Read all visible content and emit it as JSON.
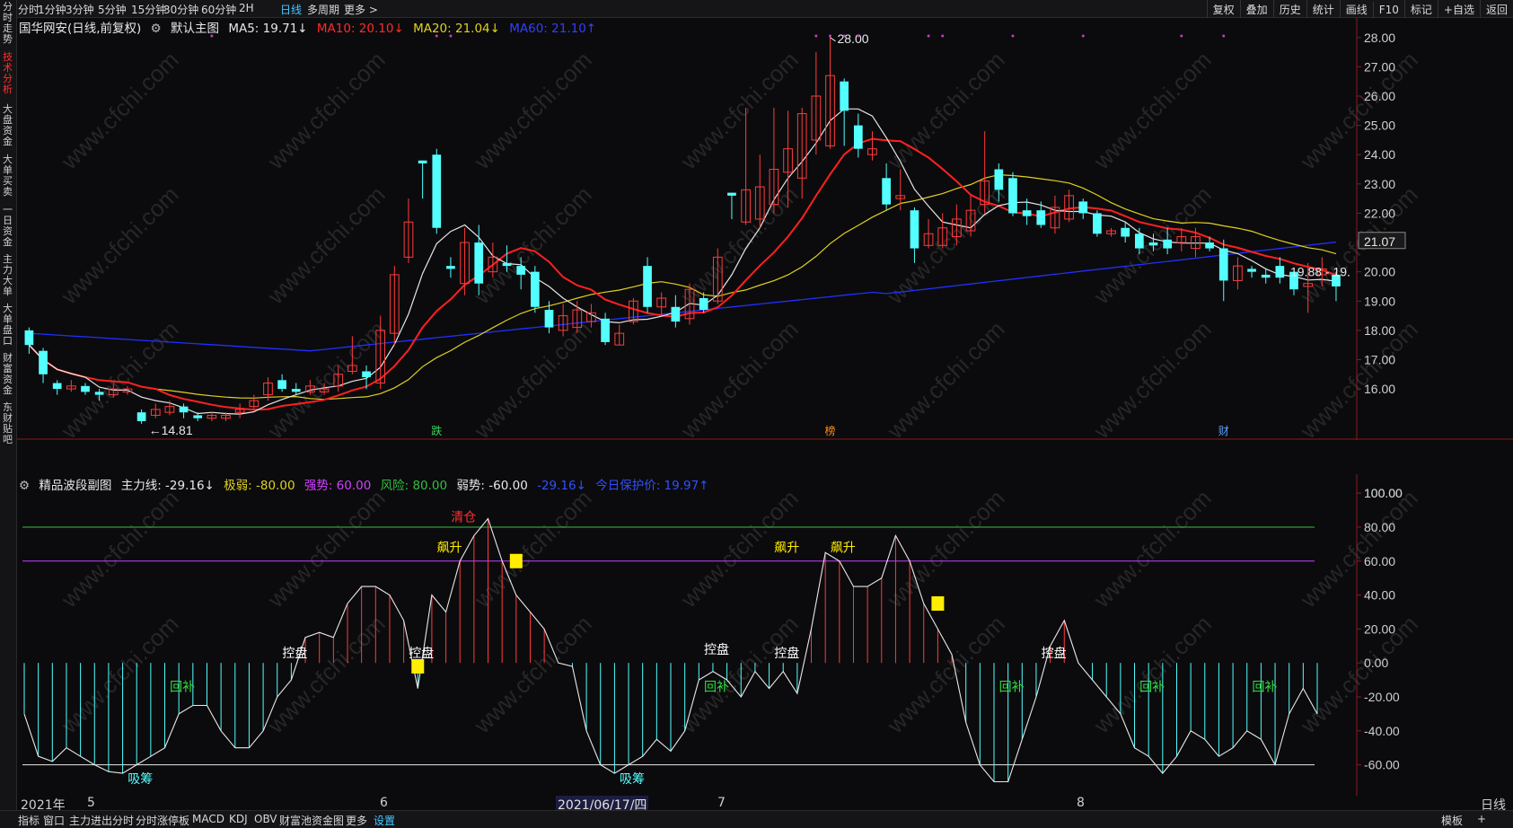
{
  "topbar": {
    "periods": [
      "分时",
      "1分钟",
      "3分钟",
      "5分钟",
      "15分钟",
      "30分钟",
      "60分钟",
      "2H",
      "日线",
      "多周期",
      "更多 >"
    ],
    "active_period": "日线",
    "tools": [
      "复权",
      "叠加",
      "历史",
      "统计",
      "画线",
      "F10",
      "标记",
      "+自选",
      "返回"
    ]
  },
  "leftnav": [
    "分时走势",
    "技术分析",
    "大盘资金",
    "大单买卖",
    "一日资金",
    "主力大单",
    "大单盘口",
    "财富资金",
    "东财贴吧"
  ],
  "leftnav_active": "技术分析",
  "main_header": {
    "stock": "国华网安(日线,前复权)",
    "template": "默认主图",
    "ma5": "MA5: 19.71↓",
    "ma10": "MA10: 20.10↓",
    "ma20": "MA20: 21.04↓",
    "ma60": "MA60: 21.10↑"
  },
  "sub_header": {
    "name": "精品波段副图",
    "main": "主力线: -29.16↓",
    "jiruo": "极弱: -80.00",
    "qiangshi": "强势: 60.00",
    "fengxian": "风险: 80.00",
    "ruoshi": "弱势: -60.00",
    "value2": "-29.16↓",
    "protect": "今日保护价: 19.97↑"
  },
  "price_labels": {
    "high": "28.00",
    "low": "14.81",
    "last_left": "19.88 - 19.",
    "last_box": "21.07"
  },
  "badges": [
    {
      "text": "跌",
      "color": "#3cd25a"
    },
    {
      "text": "榜",
      "color": "#ff8c1a"
    },
    {
      "text": "财",
      "color": "#5aa0ff"
    }
  ],
  "sub_labels": {
    "xichou": "吸筹",
    "huibu": "回补",
    "kongpan": "控盘",
    "piaosheng": "飙升",
    "qingcang": "清仓"
  },
  "dates": {
    "year": "2021年",
    "m5": "5",
    "m6": "6",
    "cursor": "2021/06/17/四",
    "m7": "7",
    "m8": "8",
    "period": "日线"
  },
  "bottombar": [
    "指标",
    "窗口",
    "主力进出分时",
    "分时涨停板",
    "MACD",
    "KDJ",
    "OBV",
    "财富池资金图",
    "更多",
    "设置"
  ],
  "bottombar_right": [
    "模板",
    "+"
  ],
  "watermark": "www.cfchi.com",
  "colors": {
    "up": "#ff3b3b",
    "down": "#54ffff",
    "ma5": "#e6e6e6",
    "ma10": "#ff2020",
    "ma20": "#e0d020",
    "ma60": "#2030ff",
    "bg": "#0b0b0d"
  },
  "chart_data": [
    {
      "type": "candlestick",
      "title": "国华网安(日线,前复权)",
      "y_ticks": [
        16.0,
        17.0,
        18.0,
        19.0,
        20.0,
        21.0,
        22.0,
        23.0,
        24.0,
        25.0,
        26.0,
        27.0,
        28.0
      ],
      "ylim": [
        14.5,
        28.3
      ],
      "candles": [
        [
          18.0,
          17.5,
          18.1,
          17.2
        ],
        [
          17.3,
          16.5,
          17.4,
          16.2
        ],
        [
          16.2,
          16.0,
          16.3,
          15.8
        ],
        [
          16.0,
          16.1,
          16.3,
          15.9
        ],
        [
          16.1,
          15.9,
          16.2,
          15.8
        ],
        [
          15.9,
          15.8,
          16.0,
          15.6
        ],
        [
          15.8,
          16.0,
          16.2,
          15.7
        ],
        [
          15.9,
          16.0,
          16.1,
          15.8
        ],
        [
          15.2,
          14.9,
          15.3,
          14.81
        ],
        [
          15.1,
          15.3,
          15.5,
          15.0
        ],
        [
          15.2,
          15.4,
          15.6,
          15.1
        ],
        [
          15.4,
          15.2,
          15.5,
          15.0
        ],
        [
          15.1,
          15.0,
          15.2,
          14.9
        ],
        [
          15.0,
          15.1,
          15.2,
          14.9
        ],
        [
          15.0,
          15.1,
          15.2,
          14.9
        ],
        [
          15.2,
          15.3,
          15.5,
          15.0
        ],
        [
          15.4,
          15.6,
          15.8,
          15.3
        ],
        [
          15.8,
          16.2,
          16.4,
          15.6
        ],
        [
          16.3,
          16.0,
          16.5,
          15.9
        ],
        [
          16.0,
          15.9,
          16.2,
          15.8
        ],
        [
          15.9,
          16.1,
          16.3,
          15.8
        ],
        [
          15.9,
          16.0,
          16.2,
          15.8
        ],
        [
          16.1,
          16.5,
          16.8,
          15.9
        ],
        [
          16.6,
          16.8,
          17.8,
          16.5
        ],
        [
          16.6,
          16.4,
          16.8,
          16.0
        ],
        [
          16.2,
          18.0,
          18.5,
          16.0
        ],
        [
          17.9,
          19.9,
          20.2,
          17.5
        ],
        [
          20.5,
          21.7,
          22.5,
          20.3
        ],
        [
          23.8,
          23.7,
          23.8,
          22.5
        ],
        [
          24.0,
          21.5,
          24.2,
          21.3
        ],
        [
          20.2,
          20.1,
          20.5,
          19.8
        ],
        [
          19.6,
          21.0,
          21.5,
          19.2
        ],
        [
          21.0,
          19.6,
          21.6,
          19.2
        ],
        [
          20.0,
          20.5,
          21.0,
          19.8
        ],
        [
          20.3,
          20.2,
          20.9,
          20.0
        ],
        [
          20.2,
          19.9,
          20.5,
          19.4
        ],
        [
          20.0,
          18.8,
          20.2,
          18.6
        ],
        [
          18.7,
          18.1,
          19.0,
          17.9
        ],
        [
          18.0,
          18.5,
          18.9,
          17.8
        ],
        [
          18.1,
          18.7,
          19.0,
          17.9
        ],
        [
          18.3,
          18.6,
          18.9,
          18.1
        ],
        [
          18.4,
          17.6,
          18.6,
          17.5
        ],
        [
          17.5,
          17.9,
          18.2,
          17.5
        ],
        [
          18.3,
          19.0,
          19.1,
          18.2
        ],
        [
          20.2,
          18.8,
          20.5,
          18.6
        ],
        [
          18.8,
          19.1,
          19.3,
          18.5
        ],
        [
          18.8,
          18.3,
          19.2,
          18.1
        ],
        [
          18.4,
          19.4,
          19.6,
          18.2
        ],
        [
          19.1,
          18.7,
          19.3,
          18.6
        ],
        [
          19.0,
          20.5,
          20.8,
          18.9
        ],
        [
          22.7,
          22.6,
          22.7,
          21.8
        ],
        [
          21.7,
          22.8,
          25.6,
          21.6
        ],
        [
          21.8,
          22.9,
          24.0,
          21.5
        ],
        [
          22.3,
          23.5,
          25.6,
          22.0
        ],
        [
          23.4,
          24.2,
          25.5,
          22.2
        ],
        [
          23.2,
          25.4,
          25.6,
          22.5
        ],
        [
          24.5,
          26.0,
          27.5,
          24.0
        ],
        [
          24.3,
          26.7,
          28.0,
          24.2
        ],
        [
          26.5,
          25.5,
          26.6,
          24.3
        ],
        [
          25.0,
          24.2,
          25.4,
          23.9
        ],
        [
          24.0,
          24.2,
          24.8,
          23.8
        ],
        [
          23.2,
          22.3,
          23.7,
          22.1
        ],
        [
          22.5,
          22.6,
          23.5,
          22.1
        ],
        [
          22.1,
          20.8,
          22.2,
          20.3
        ],
        [
          20.9,
          21.3,
          21.8,
          20.8
        ],
        [
          20.9,
          21.5,
          22.0,
          20.8
        ],
        [
          21.2,
          21.8,
          22.3,
          20.9
        ],
        [
          21.4,
          22.1,
          22.6,
          21.2
        ],
        [
          22.3,
          23.1,
          24.8,
          22.0
        ],
        [
          23.5,
          22.8,
          23.7,
          22.4
        ],
        [
          23.2,
          22.0,
          23.4,
          21.9
        ],
        [
          22.1,
          21.9,
          22.5,
          21.6
        ],
        [
          22.1,
          21.6,
          22.4,
          21.5
        ],
        [
          21.5,
          22.2,
          22.6,
          21.3
        ],
        [
          21.8,
          22.6,
          22.8,
          21.7
        ],
        [
          22.4,
          22.0,
          22.5,
          21.8
        ],
        [
          22.0,
          21.3,
          22.1,
          21.2
        ],
        [
          21.3,
          21.4,
          21.5,
          21.2
        ],
        [
          21.5,
          21.2,
          21.7,
          21.0
        ],
        [
          21.3,
          20.8,
          21.5,
          20.6
        ],
        [
          21.0,
          20.9,
          21.3,
          20.7
        ],
        [
          21.1,
          20.8,
          21.5,
          20.6
        ],
        [
          21.0,
          21.2,
          21.5,
          20.7
        ],
        [
          20.8,
          21.2,
          21.5,
          20.5
        ],
        [
          21.0,
          20.8,
          21.2,
          20.7
        ],
        [
          20.8,
          19.7,
          21.1,
          19.0
        ],
        [
          19.7,
          20.2,
          20.5,
          19.4
        ],
        [
          20.1,
          20.0,
          20.2,
          19.8
        ],
        [
          19.9,
          19.8,
          20.1,
          19.6
        ],
        [
          20.2,
          19.8,
          20.5,
          19.6
        ],
        [
          20.0,
          19.4,
          20.1,
          19.2
        ],
        [
          19.5,
          19.6,
          20.3,
          18.6
        ],
        [
          19.9,
          20.1,
          20.5,
          19.5
        ],
        [
          19.9,
          19.5,
          20.0,
          19.0
        ]
      ]
    },
    {
      "type": "line",
      "title": "精品波段副图",
      "y_ticks": [
        -60,
        -40,
        -20,
        0,
        20,
        40,
        60,
        80,
        100
      ],
      "ylim": [
        -75,
        108
      ],
      "reference_lines": [
        80,
        60,
        -60,
        -80
      ],
      "series": [
        {
          "name": "主力线",
          "values": [
            -30,
            -55,
            -58,
            -50,
            -55,
            -60,
            -64,
            -65,
            -60,
            -55,
            -50,
            -30,
            -25,
            -25,
            -40,
            -50,
            -50,
            -40,
            -20,
            -10,
            15,
            18,
            15,
            35,
            45,
            45,
            40,
            25,
            -15,
            40,
            30,
            60,
            75,
            85,
            60,
            40,
            30,
            20,
            0,
            -2,
            -40,
            -60,
            -65,
            -60,
            -55,
            -45,
            -52,
            -40,
            -10,
            -5,
            -10,
            -20,
            -5,
            -15,
            -5,
            -18,
            20,
            65,
            60,
            45,
            45,
            50,
            75,
            60,
            35,
            20,
            5,
            -35,
            -60,
            -70,
            -70,
            -45,
            -20,
            10,
            25,
            0,
            -10,
            -20,
            -30,
            -50,
            -55,
            -65,
            -55,
            -40,
            -45,
            -55,
            -50,
            -40,
            -45,
            -60,
            -30,
            -15,
            -30
          ]
        }
      ],
      "markers": [
        {
          "text": "吸筹"
        },
        {
          "text": "回补"
        },
        {
          "text": "控盘"
        },
        {
          "text": "飙升"
        },
        {
          "text": "清仓"
        }
      ]
    }
  ]
}
